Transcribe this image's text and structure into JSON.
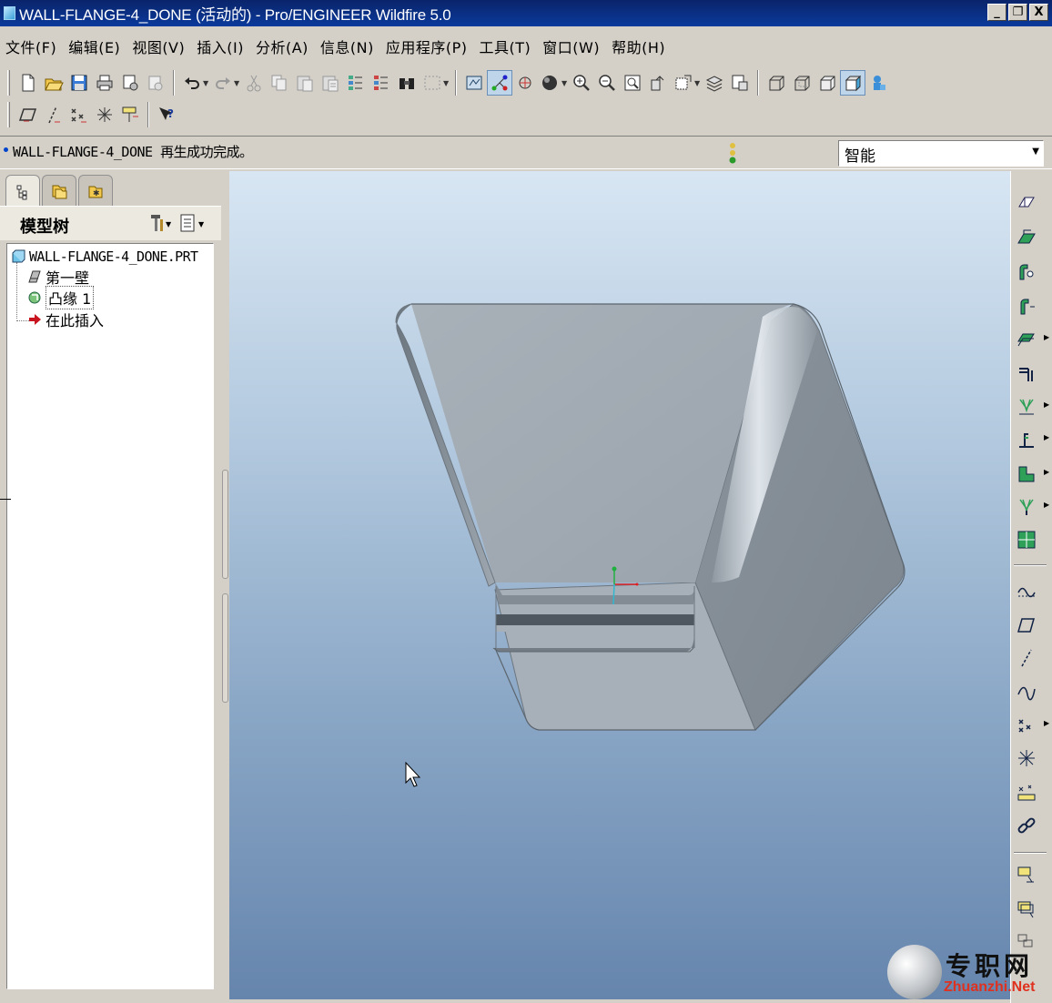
{
  "window": {
    "title": "WALL-FLANGE-4_DONE (活动的) - Pro/ENGINEER Wildfire 5.0",
    "minimize": "_",
    "restore": "❐",
    "close": "X"
  },
  "menu": [
    "文件(F)",
    "编辑(E)",
    "视图(V)",
    "插入(I)",
    "分析(A)",
    "信息(N)",
    "应用程序(P)",
    "工具(T)",
    "窗口(W)",
    "帮助(H)"
  ],
  "toolbar_top": {
    "icons": [
      "new-icon",
      "open-icon",
      "save-icon",
      "print-icon",
      "send-icon",
      "mail-icon",
      "undo-icon",
      "redo-icon",
      "cut-icon",
      "copy-icon",
      "paste-icon",
      "paste-special-icon",
      "regenerate-icon",
      "regen-manager-icon",
      "find-icon",
      "select-box-icon",
      "repaint-icon",
      "spin-center-icon",
      "orient-icon",
      "shading-icon",
      "zoom-in-icon",
      "zoom-out-icon",
      "refit-icon",
      "reorient-icon",
      "saved-views-icon",
      "layers-icon",
      "view-manager-icon",
      "wireframe-icon",
      "hidden-line-icon",
      "no-hidden-icon",
      "shaded-icon",
      "datum-display-icon"
    ]
  },
  "toolbar_second": {
    "icons": [
      "datum-plane-display-icon",
      "datum-axis-display-icon",
      "datum-point-display-icon",
      "csys-display-icon",
      "annotation-display-icon",
      "context-help-icon"
    ]
  },
  "message": {
    "text": "WALL-FLANGE-4_DONE 再生成功完成。"
  },
  "filter": {
    "value": "智能"
  },
  "model_tree": {
    "title": "模型树",
    "root": "WALL-FLANGE-4_DONE.PRT",
    "items": [
      "第一壁",
      "凸缘 1",
      "在此插入"
    ]
  },
  "right_toolbar": {
    "icons": [
      "unattached-wall-icon",
      "flat-wall-icon",
      "flange-wall-icon",
      "extend-wall-icon",
      "merge-icon",
      "rip-icon",
      "bend-icon",
      "edge-bend-icon",
      "unbend-icon",
      "bend-back-icon",
      "flat-pattern-icon",
      "sketch-icon",
      "datum-plane-icon",
      "datum-axis-icon",
      "datum-curve-icon",
      "datum-point-icon",
      "csys-icon",
      "analysis-icon",
      "chain-icon",
      "form-icon",
      "punch-icon",
      "notch-icon"
    ]
  },
  "watermark": {
    "cn": "专职网",
    "en": "Zhuanzhi.Net"
  },
  "colors": {
    "titlebar": "#0a246a",
    "viewport_top": "#d8e6f3",
    "viewport_bottom": "#6685ad",
    "part": "#a0a8b0"
  }
}
